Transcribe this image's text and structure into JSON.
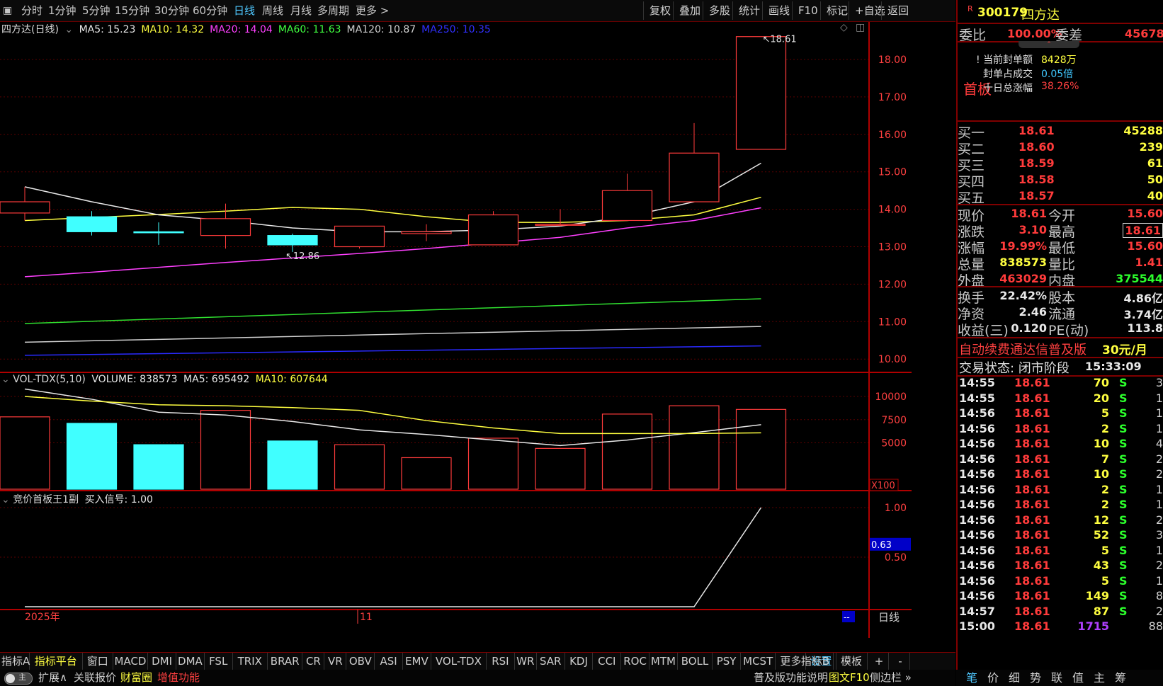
{
  "toolbar": {
    "periods": [
      "分时",
      "1分钟",
      "5分钟",
      "15分钟",
      "30分钟",
      "60分钟",
      "日线",
      "周线",
      "月线",
      "多周期",
      "更多 >"
    ],
    "active_period": "日线",
    "right_buttons": [
      "复权",
      "叠加",
      "多股",
      "统计",
      "画线",
      "F10",
      "标记",
      "+自选",
      "返回"
    ]
  },
  "chart": {
    "title": "四方达(日线)",
    "ma": [
      {
        "label": "MA5: 15.23",
        "color": "#e8e8e8"
      },
      {
        "label": "MA10: 14.32",
        "color": "#ffff40"
      },
      {
        "label": "MA20: 14.04",
        "color": "#ff40ff"
      },
      {
        "label": "MA60: 11.63",
        "color": "#40ff40"
      },
      {
        "label": "MA120: 10.87",
        "color": "#d0d0d0"
      },
      {
        "label": "MA250: 10.35",
        "color": "#3030ff"
      }
    ],
    "high_marker": "18.61",
    "low_marker": "12.86",
    "y_ticks": [
      "18.00",
      "17.00",
      "16.00",
      "15.00",
      "14.00",
      "13.00",
      "12.00",
      "11.00",
      "10.00"
    ],
    "candles": [
      {
        "o": 14.2,
        "c": 13.9,
        "h": 14.6,
        "l": 13.7,
        "up": true
      },
      {
        "o": 13.8,
        "c": 13.4,
        "h": 13.95,
        "l": 13.3,
        "up": false
      },
      {
        "o": 13.4,
        "c": 13.38,
        "h": 13.65,
        "l": 13.05,
        "up": false
      },
      {
        "o": 13.3,
        "c": 13.75,
        "h": 14.15,
        "l": 12.95,
        "up": true
      },
      {
        "o": 13.3,
        "c": 13.05,
        "h": 13.35,
        "l": 12.86,
        "up": false
      },
      {
        "o": 13.0,
        "c": 13.55,
        "h": 13.55,
        "l": 12.95,
        "up": true
      },
      {
        "o": 13.35,
        "c": 13.4,
        "h": 13.6,
        "l": 13.15,
        "up": true
      },
      {
        "o": 13.05,
        "c": 13.85,
        "h": 13.95,
        "l": 13.05,
        "up": true
      },
      {
        "o": 13.6,
        "c": 13.6,
        "h": 14.0,
        "l": 13.55,
        "up": true
      },
      {
        "o": 13.7,
        "c": 14.5,
        "h": 14.95,
        "l": 13.7,
        "up": true
      },
      {
        "o": 14.2,
        "c": 15.5,
        "h": 16.3,
        "l": 14.2,
        "up": true
      },
      {
        "o": 15.6,
        "c": 18.61,
        "h": 18.61,
        "l": 15.6,
        "up": true
      }
    ],
    "ma5_line": [
      14.6,
      14.2,
      13.85,
      13.7,
      13.5,
      13.4,
      13.4,
      13.45,
      13.55,
      13.8,
      14.2,
      15.23
    ],
    "ma10_line": [
      13.7,
      13.78,
      13.86,
      13.95,
      14.05,
      14.0,
      13.8,
      13.65,
      13.65,
      13.7,
      13.85,
      14.32
    ],
    "ma20_line": [
      12.2,
      12.32,
      12.45,
      12.58,
      12.7,
      12.82,
      12.95,
      13.1,
      13.25,
      13.5,
      13.7,
      14.04
    ],
    "ma60_line": [
      10.95,
      11.61
    ],
    "ma120_line": [
      10.45,
      10.87
    ],
    "ma250_line": [
      10.1,
      10.35
    ]
  },
  "volume": {
    "title": "VOL-TDX(5,10)",
    "volume_label": "VOLUME: 838573",
    "ma5_label": "MA5: 695492",
    "ma10_label": "MA10: 607644",
    "y_ticks": [
      "10000",
      "7500",
      "5000"
    ],
    "unit": "X100",
    "bars": [
      {
        "v": 7800,
        "up": true
      },
      {
        "v": 7100,
        "up": false
      },
      {
        "v": 4800,
        "up": false
      },
      {
        "v": 8500,
        "up": true
      },
      {
        "v": 5200,
        "up": false
      },
      {
        "v": 4800,
        "up": true
      },
      {
        "v": 3400,
        "up": true
      },
      {
        "v": 5500,
        "up": true
      },
      {
        "v": 4400,
        "up": true
      },
      {
        "v": 8100,
        "up": true
      },
      {
        "v": 9000,
        "up": true
      },
      {
        "v": 8600,
        "up": true
      }
    ],
    "ma5_line": [
      10800,
      9700,
      8300,
      8000,
      7300,
      6400,
      5900,
      5300,
      4700,
      5300,
      6100,
      6955
    ],
    "ma10_line": [
      10000,
      9500,
      9100,
      9000,
      8800,
      8500,
      7400,
      6600,
      6000,
      6000,
      6000,
      6076
    ]
  },
  "indicator": {
    "title": "竞价首板王1副",
    "signal_label": "买入信号: 1.00",
    "y_ticks": [
      "1.00",
      "0.50"
    ],
    "current_value": "0.63"
  },
  "date_axis": {
    "left": "2025年",
    "mid": "11",
    "end": "--",
    "period": "日线"
  },
  "quote": {
    "code": "300179",
    "name": "四方达",
    "badge": "R",
    "weibi_label": "委比",
    "weibi_value": "100.00%",
    "weicha_label": "委差",
    "weicha_value": "45678",
    "board_label": "首板",
    "info": [
      {
        "label": "当前封单额",
        "value": "8428万"
      },
      {
        "label": "封单占成交",
        "value": "0.05倍"
      },
      {
        "label": "十日总涨幅",
        "value": "38.26%"
      }
    ],
    "bids": [
      {
        "label": "买一",
        "price": "18.61",
        "vol": "45288"
      },
      {
        "label": "买二",
        "price": "18.60",
        "vol": "239"
      },
      {
        "label": "买三",
        "price": "18.59",
        "vol": "61"
      },
      {
        "label": "买四",
        "price": "18.58",
        "vol": "50"
      },
      {
        "label": "买五",
        "price": "18.57",
        "vol": "40"
      }
    ],
    "stats": [
      {
        "l1": "现价",
        "v1": "18.61",
        "c1": "red",
        "l2": "今开",
        "v2": "15.60",
        "c2": "red"
      },
      {
        "l1": "涨跌",
        "v1": "3.10",
        "c1": "red",
        "l2": "最高",
        "v2": "18.61",
        "c2": "red"
      },
      {
        "l1": "涨幅",
        "v1": "19.99%",
        "c1": "red",
        "l2": "最低",
        "v2": "15.60",
        "c2": "red"
      },
      {
        "l1": "总量",
        "v1": "838573",
        "c1": "yellow",
        "l2": "量比",
        "v2": "1.41",
        "c2": "red"
      },
      {
        "l1": "外盘",
        "v1": "463029",
        "c1": "red",
        "l2": "内盘",
        "v2": "375544",
        "c2": "green"
      }
    ],
    "stats2": [
      {
        "l1": "换手",
        "v1": "22.42%",
        "l2": "股本",
        "v2": "4.86亿"
      },
      {
        "l1": "净资",
        "v1": "2.46",
        "l2": "流通",
        "v2": "3.74亿"
      },
      {
        "l1": "收益(三)",
        "v1": "0.120",
        "l2": "PE(动)",
        "v2": "113.8"
      }
    ],
    "promo": "自动续费通达信普及版",
    "promo_price": "30元/月",
    "trade_state_label": "交易状态: 闭市阶段",
    "trade_time": "15:33:09"
  },
  "ticks": [
    {
      "t": "14:55",
      "p": "18.61",
      "v": "70",
      "s": "S",
      "n": "3"
    },
    {
      "t": "14:55",
      "p": "18.61",
      "v": "20",
      "s": "S",
      "n": "1"
    },
    {
      "t": "14:56",
      "p": "18.61",
      "v": "5",
      "s": "S",
      "n": "1"
    },
    {
      "t": "14:56",
      "p": "18.61",
      "v": "2",
      "s": "S",
      "n": "1"
    },
    {
      "t": "14:56",
      "p": "18.61",
      "v": "10",
      "s": "S",
      "n": "4"
    },
    {
      "t": "14:56",
      "p": "18.61",
      "v": "7",
      "s": "S",
      "n": "2"
    },
    {
      "t": "14:56",
      "p": "18.61",
      "v": "10",
      "s": "S",
      "n": "2"
    },
    {
      "t": "14:56",
      "p": "18.61",
      "v": "2",
      "s": "S",
      "n": "1"
    },
    {
      "t": "14:56",
      "p": "18.61",
      "v": "2",
      "s": "S",
      "n": "1"
    },
    {
      "t": "14:56",
      "p": "18.61",
      "v": "12",
      "s": "S",
      "n": "2"
    },
    {
      "t": "14:56",
      "p": "18.61",
      "v": "52",
      "s": "S",
      "n": "3"
    },
    {
      "t": "14:56",
      "p": "18.61",
      "v": "5",
      "s": "S",
      "n": "1"
    },
    {
      "t": "14:56",
      "p": "18.61",
      "v": "43",
      "s": "S",
      "n": "2"
    },
    {
      "t": "14:56",
      "p": "18.61",
      "v": "5",
      "s": "S",
      "n": "1"
    },
    {
      "t": "14:56",
      "p": "18.61",
      "v": "149",
      "s": "S",
      "n": "8"
    },
    {
      "t": "14:57",
      "p": "18.61",
      "v": "87",
      "s": "S",
      "n": "2"
    },
    {
      "t": "15:00",
      "p": "18.61",
      "v": "1715",
      "s": "",
      "n": "88"
    }
  ],
  "bottom_tabs": [
    "指标A",
    "指标平台",
    "窗口",
    "MACD",
    "DMI",
    "DMA",
    "FSL",
    "TRIX",
    "BRAR",
    "CR",
    "VR",
    "OBV",
    "ASI",
    "EMV",
    "VOL-TDX",
    "RSI",
    "WR",
    "SAR",
    "KDJ",
    "CCI",
    "ROC",
    "MTM",
    "BOLL",
    "PSY",
    "MCST",
    "更多",
    "设置"
  ],
  "bottom_tabs_right": [
    "指标B",
    "模板",
    "+",
    "-"
  ],
  "bottom_row2": {
    "toggle": "主",
    "items": [
      "扩展∧",
      "关联报价",
      "财富圈",
      "增值功能"
    ],
    "right": [
      "普及版功能说明",
      "图文F10",
      "侧边栏 »"
    ]
  },
  "right_tabs": [
    "笔",
    "价",
    "细",
    "势",
    "联",
    "值",
    "主",
    "筹"
  ]
}
